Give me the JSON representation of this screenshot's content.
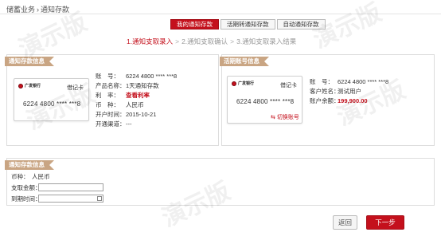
{
  "breadcrumb": {
    "parent": "储蓄业务",
    "separator": "›",
    "current": "通知存款"
  },
  "tabs": [
    {
      "label": "我的通知存款",
      "active": true
    },
    {
      "label": "活期转通知存款",
      "active": false
    },
    {
      "label": "自动通知存款",
      "active": false
    }
  ],
  "steps": [
    {
      "label": "1.通知支取录入",
      "active": true
    },
    {
      "label": "2.通知支取确认",
      "active": false
    },
    {
      "label": "3.通知支取录入结果",
      "active": false
    }
  ],
  "step_arrow": ">",
  "deposit_panel": {
    "title": "通知存款信息",
    "card": {
      "bank_name": "广发银行",
      "card_type": "借记卡",
      "card_number": "6224 4800 **** ***8"
    },
    "rows": [
      {
        "label": "账　号：",
        "value": "6224 4800 **** ***8",
        "red": false
      },
      {
        "label": "产品名称：",
        "value": "1天通知存款",
        "red": false
      },
      {
        "label": "利　率：",
        "value": "查看利率",
        "red": true
      },
      {
        "label": "币　种：",
        "value": "人民币",
        "red": false
      },
      {
        "label": "开户时间：",
        "value": "2015-10-21",
        "red": false
      },
      {
        "label": "开通渠道：",
        "value": "---",
        "red": false
      }
    ]
  },
  "demand_panel": {
    "title": "活期账号信息",
    "card": {
      "bank_name": "广发银行",
      "card_type": "借记卡",
      "card_number": "6224 4800 **** ***8"
    },
    "switch_label": "切换账号",
    "rows": [
      {
        "label": "账　号：",
        "value": "6224 4800 **** ***8",
        "red": false
      },
      {
        "label": "客户姓名：",
        "value": "测试用户",
        "red": false
      },
      {
        "label": "账户余额：",
        "value": "199,900.00",
        "red": true
      }
    ]
  },
  "withdraw_panel": {
    "title": "通知存款信息",
    "currency_label": "币种：",
    "currency_value": "人民币",
    "amount_label": "支取金额：",
    "amount_value": "",
    "date_label": "到期时间：",
    "date_value": ""
  },
  "buttons": {
    "back": "返回",
    "next": "下一步"
  },
  "watermark_text": "演示版",
  "colors": {
    "accent": "#c4101c",
    "ribbon": "#c9a583"
  }
}
